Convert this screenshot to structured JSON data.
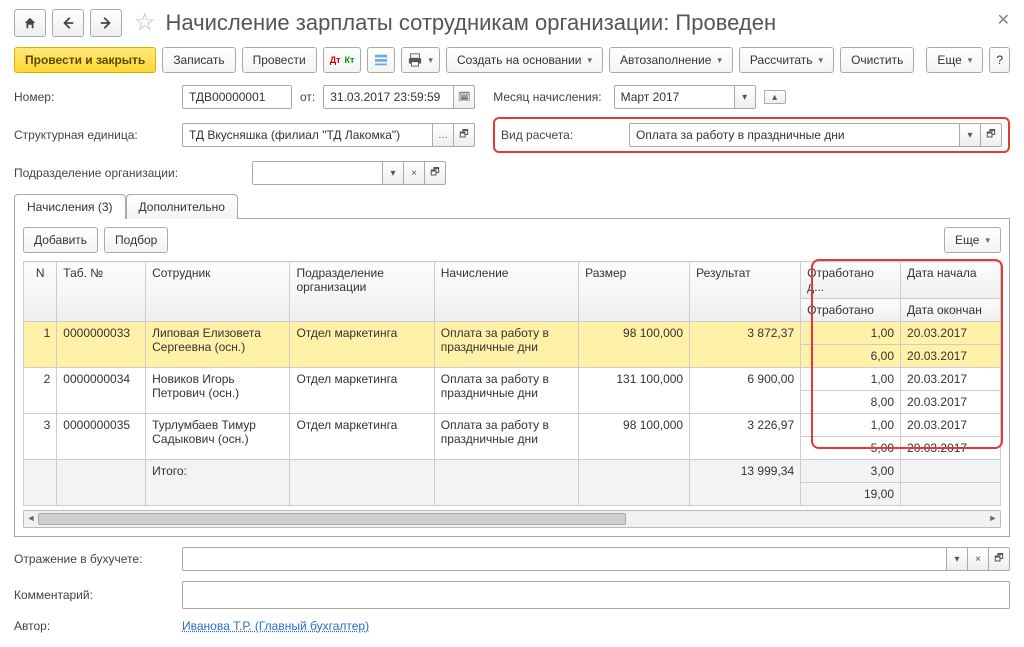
{
  "window": {
    "title": "Начисление зарплаты сотрудникам организации: Проведен"
  },
  "toolbar": {
    "post_close": "Провести и закрыть",
    "save": "Записать",
    "post": "Провести",
    "create_from": "Создать на основании",
    "autofill": "Автозаполнение",
    "calculate": "Рассчитать",
    "clear": "Очистить",
    "more": "Еще"
  },
  "fields": {
    "number_label": "Номер:",
    "number_value": "ТДВ00000001",
    "from_label": "от:",
    "date_value": "31.03.2017 23:59:59",
    "month_label": "Месяц начисления:",
    "month_value": "Март 2017",
    "unit_label": "Структурная единица:",
    "unit_value": "ТД Вкусняшка (филиал \"ТД Лакомка\")",
    "calc_label": "Вид расчета:",
    "calc_value": "Оплата за работу в праздничные дни",
    "dept_label": "Подразделение организации:",
    "dept_value": ""
  },
  "tabs": {
    "accruals": "Начисления (3)",
    "extra": "Дополнительно"
  },
  "table_toolbar": {
    "add": "Добавить",
    "pick": "Подбор",
    "more": "Еще"
  },
  "columns": {
    "n": "N",
    "tab": "Таб. №",
    "emp": "Сотрудник",
    "dept": "Подразделение организации",
    "accr": "Начисление",
    "size": "Размер",
    "result": "Результат",
    "worked_d": "Отработано д...",
    "worked": "Отработано",
    "date_start": "Дата начала",
    "date_end": "Дата окончан"
  },
  "rows": [
    {
      "n": "1",
      "tab": "0000000033",
      "emp": "Липовая Елизовета Сергеевна (осн.)",
      "dept": "Отдел маркетинга",
      "accr": "Оплата за работу в праздничные дни",
      "size": "98 100,000",
      "result": "3 872,37",
      "w1": "1,00",
      "d1": "20.03.2017",
      "w2": "6,00",
      "d2": "20.03.2017",
      "sel": true
    },
    {
      "n": "2",
      "tab": "0000000034",
      "emp": "Новиков Игорь Петрович (осн.)",
      "dept": "Отдел маркетинга",
      "accr": "Оплата за работу в праздничные дни",
      "size": "131 100,000",
      "result": "6 900,00",
      "w1": "1,00",
      "d1": "20.03.2017",
      "w2": "8,00",
      "d2": "20.03.2017"
    },
    {
      "n": "3",
      "tab": "0000000035",
      "emp": "Турлумбаев Тимур Садыкович (осн.)",
      "dept": "Отдел маркетинга",
      "accr": "Оплата за работу в праздничные дни",
      "size": "98 100,000",
      "result": "3 226,97",
      "w1": "1,00",
      "d1": "20.03.2017",
      "w2": "5,00",
      "d2": "20.03.2017"
    }
  ],
  "totals": {
    "label": "Итого:",
    "result": "13 999,34",
    "w1": "3,00",
    "w2": "19,00"
  },
  "footer": {
    "accounting_label": "Отражение в бухучете:",
    "comment_label": "Комментарий:",
    "author_label": "Автор:",
    "author_value": "Иванова Т.Р. (Главный бухгалтер)"
  }
}
